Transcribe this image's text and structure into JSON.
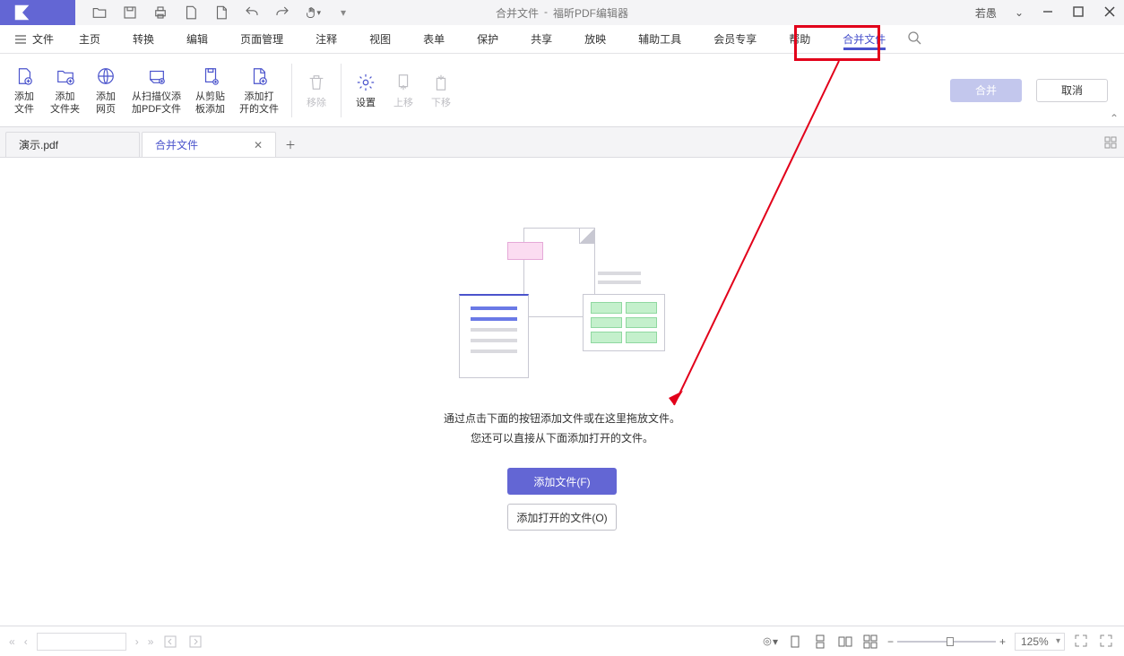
{
  "title": {
    "doc": "合并文件",
    "app": "福昕PDF编辑器"
  },
  "user": "若愚",
  "menubar": {
    "file": "文件",
    "items": [
      "主页",
      "转换",
      "编辑",
      "页面管理",
      "注释",
      "视图",
      "表单",
      "保护",
      "共享",
      "放映",
      "辅助工具",
      "会员专享",
      "帮助",
      "合并文件"
    ],
    "activeIndex": 13
  },
  "ribbon": {
    "buttons": [
      {
        "l1": "添加",
        "l2": "文件",
        "disabled": false
      },
      {
        "l1": "添加",
        "l2": "文件夹",
        "disabled": false
      },
      {
        "l1": "添加",
        "l2": "网页",
        "disabled": false
      },
      {
        "l1": "从扫描仪添",
        "l2": "加PDF文件",
        "disabled": false
      },
      {
        "l1": "从剪贴",
        "l2": "板添加",
        "disabled": false
      },
      {
        "l1": "添加打",
        "l2": "开的文件",
        "disabled": false
      },
      {
        "l1": "移除",
        "l2": "",
        "disabled": true,
        "sep": true
      },
      {
        "l1": "设置",
        "l2": "",
        "disabled": false,
        "sep": true
      },
      {
        "l1": "上移",
        "l2": "",
        "disabled": true
      },
      {
        "l1": "下移",
        "l2": "",
        "disabled": true
      }
    ],
    "merge": "合并",
    "cancel": "取消"
  },
  "tabs": [
    {
      "label": "演示.pdf",
      "active": false,
      "accent": false
    },
    {
      "label": "合并文件",
      "active": true,
      "accent": true
    }
  ],
  "main": {
    "line1": "通过点击下面的按钮添加文件或在这里拖放文件。",
    "line2": "您还可以直接从下面添加打开的文件。",
    "addFiles": "添加文件(F)",
    "addOpen": "添加打开的文件(O)"
  },
  "status": {
    "zoom": "125%"
  }
}
